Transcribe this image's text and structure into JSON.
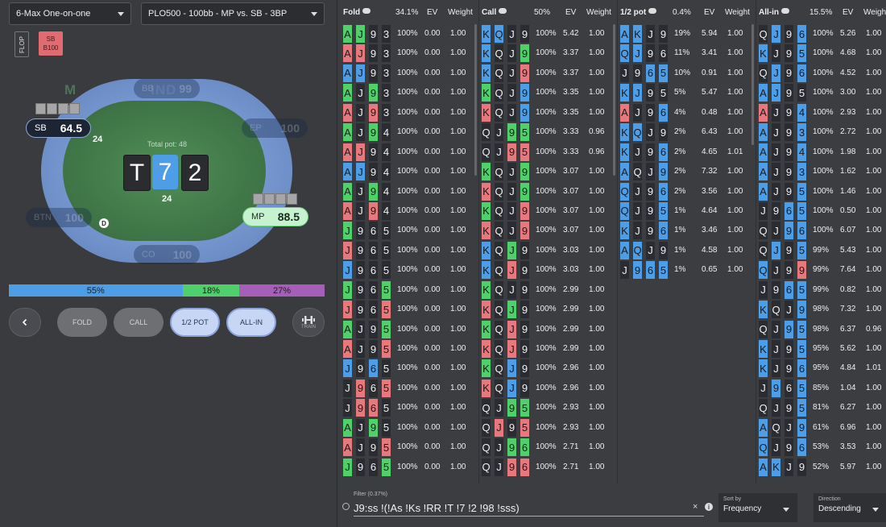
{
  "header": {
    "game_select": "6-Max One-on-one",
    "spot_select": "PLO500 - 100bb - MP vs. SB - 3BP"
  },
  "street_chip": "FLOP",
  "action_chip": {
    "line1": "SB",
    "line2": "B100"
  },
  "table": {
    "logo": "M",
    "logo_suffix": "IND",
    "total_pot": "Total pot: 48",
    "board": [
      {
        "rank": "T",
        "suit": "c"
      },
      {
        "rank": "7",
        "suit": "d"
      },
      {
        "rank": "2",
        "suit": "c"
      }
    ],
    "seats": {
      "bb": {
        "pos": "BB",
        "stack": "99"
      },
      "sb": {
        "pos": "SB",
        "stack": "64.5",
        "bet": "24"
      },
      "ep": {
        "pos": "EP",
        "stack": "100"
      },
      "btn": {
        "pos": "BTN",
        "stack": "100"
      },
      "mp": {
        "pos": "MP",
        "stack": "88.5",
        "bet": "24"
      },
      "co": {
        "pos": "CO",
        "stack": "100"
      }
    },
    "dealer": "D"
  },
  "freq_bar": [
    {
      "label": "55%",
      "value": 55,
      "color": "#4d9ee6"
    },
    {
      "label": "18%",
      "value": 18,
      "color": "#4fd06b"
    },
    {
      "label": "27%",
      "value": 27,
      "color": "#a65fb8"
    }
  ],
  "actions": {
    "fold": "FOLD",
    "call": "CALL",
    "half_pot": "1/2 POT",
    "all_in": "ALL-IN",
    "train": "TRAIN"
  },
  "columns": [
    {
      "name": "Fold",
      "pct": "34.1%",
      "ev_label": "EV",
      "weight_label": "Weight",
      "rows": [
        {
          "cards": [
            "As",
            "Js",
            "9c",
            "3c"
          ],
          "freq": "100%",
          "ev": "0.00",
          "w": "1.00"
        },
        {
          "cards": [
            "Ah",
            "Jh",
            "9c",
            "3c"
          ],
          "freq": "100%",
          "ev": "0.00",
          "w": "1.00"
        },
        {
          "cards": [
            "Ad",
            "Jd",
            "9c",
            "3c"
          ],
          "freq": "100%",
          "ev": "0.00",
          "w": "1.00"
        },
        {
          "cards": [
            "As",
            "Jc",
            "9s",
            "3c"
          ],
          "freq": "100%",
          "ev": "0.00",
          "w": "1.00"
        },
        {
          "cards": [
            "Ah",
            "Jc",
            "9h",
            "3c"
          ],
          "freq": "100%",
          "ev": "0.00",
          "w": "1.00"
        },
        {
          "cards": [
            "As",
            "Jc",
            "9s",
            "4c"
          ],
          "freq": "100%",
          "ev": "0.00",
          "w": "1.00"
        },
        {
          "cards": [
            "Ah",
            "Jh",
            "9c",
            "4c"
          ],
          "freq": "100%",
          "ev": "0.00",
          "w": "1.00"
        },
        {
          "cards": [
            "Ad",
            "Jd",
            "9c",
            "4c"
          ],
          "freq": "100%",
          "ev": "0.00",
          "w": "1.00"
        },
        {
          "cards": [
            "As",
            "Jc",
            "9s",
            "4c"
          ],
          "freq": "100%",
          "ev": "0.00",
          "w": "1.00"
        },
        {
          "cards": [
            "Ah",
            "Jc",
            "9h",
            "4c"
          ],
          "freq": "100%",
          "ev": "0.00",
          "w": "1.00"
        },
        {
          "cards": [
            "Js",
            "9c",
            "6c",
            "5c"
          ],
          "freq": "100%",
          "ev": "0.00",
          "w": "1.00"
        },
        {
          "cards": [
            "Jh",
            "9c",
            "6c",
            "5c"
          ],
          "freq": "100%",
          "ev": "0.00",
          "w": "1.00"
        },
        {
          "cards": [
            "Jd",
            "9c",
            "6c",
            "5c"
          ],
          "freq": "100%",
          "ev": "0.00",
          "w": "1.00"
        },
        {
          "cards": [
            "Js",
            "9c",
            "6c",
            "5s"
          ],
          "freq": "100%",
          "ev": "0.00",
          "w": "1.00"
        },
        {
          "cards": [
            "Jh",
            "9c",
            "6c",
            "5h"
          ],
          "freq": "100%",
          "ev": "0.00",
          "w": "1.00"
        },
        {
          "cards": [
            "As",
            "Jc",
            "9c",
            "5s"
          ],
          "freq": "100%",
          "ev": "0.00",
          "w": "1.00"
        },
        {
          "cards": [
            "Ah",
            "Jc",
            "9c",
            "5h"
          ],
          "freq": "100%",
          "ev": "0.00",
          "w": "1.00"
        },
        {
          "cards": [
            "Jd",
            "9c",
            "6d",
            "5c"
          ],
          "freq": "100%",
          "ev": "0.00",
          "w": "1.00"
        },
        {
          "cards": [
            "Jc",
            "9h",
            "6c",
            "5h"
          ],
          "freq": "100%",
          "ev": "0.00",
          "w": "1.00"
        },
        {
          "cards": [
            "Jc",
            "9h",
            "6h",
            "5c"
          ],
          "freq": "100%",
          "ev": "0.00",
          "w": "1.00"
        },
        {
          "cards": [
            "As",
            "Jc",
            "9s",
            "5c"
          ],
          "freq": "100%",
          "ev": "0.00",
          "w": "1.00"
        },
        {
          "cards": [
            "Ah",
            "Jc",
            "9c",
            "5h"
          ],
          "freq": "100%",
          "ev": "0.00",
          "w": "1.00"
        },
        {
          "cards": [
            "Js",
            "9c",
            "6c",
            "5s"
          ],
          "freq": "100%",
          "ev": "0.00",
          "w": "1.00"
        }
      ]
    },
    {
      "name": "Call",
      "pct": "50%",
      "ev_label": "EV",
      "weight_label": "Weight",
      "rows": [
        {
          "cards": [
            "Kd",
            "Qd",
            "Jc",
            "9c"
          ],
          "freq": "100%",
          "ev": "5.42",
          "w": "1.00"
        },
        {
          "cards": [
            "Kd",
            "Qc",
            "Jc",
            "9s"
          ],
          "freq": "100%",
          "ev": "3.37",
          "w": "1.00"
        },
        {
          "cards": [
            "Kd",
            "Qc",
            "Jc",
            "9h"
          ],
          "freq": "100%",
          "ev": "3.37",
          "w": "1.00"
        },
        {
          "cards": [
            "Ks",
            "Qc",
            "Jc",
            "9d"
          ],
          "freq": "100%",
          "ev": "3.35",
          "w": "1.00"
        },
        {
          "cards": [
            "Kh",
            "Qc",
            "Jc",
            "9d"
          ],
          "freq": "100%",
          "ev": "3.35",
          "w": "1.00"
        },
        {
          "cards": [
            "Qc",
            "Jc",
            "9s",
            "5s"
          ],
          "freq": "100%",
          "ev": "3.33",
          "w": "0.96"
        },
        {
          "cards": [
            "Qc",
            "Jc",
            "9h",
            "5h"
          ],
          "freq": "100%",
          "ev": "3.33",
          "w": "0.96"
        },
        {
          "cards": [
            "Ks",
            "Qc",
            "Jc",
            "9s"
          ],
          "freq": "100%",
          "ev": "3.07",
          "w": "1.00"
        },
        {
          "cards": [
            "Kh",
            "Qc",
            "Jc",
            "9s"
          ],
          "freq": "100%",
          "ev": "3.07",
          "w": "1.00"
        },
        {
          "cards": [
            "Ks",
            "Qc",
            "Jc",
            "9h"
          ],
          "freq": "100%",
          "ev": "3.07",
          "w": "1.00"
        },
        {
          "cards": [
            "Kh",
            "Qc",
            "Jc",
            "9h"
          ],
          "freq": "100%",
          "ev": "3.07",
          "w": "1.00"
        },
        {
          "cards": [
            "Kd",
            "Qc",
            "Js",
            "9c"
          ],
          "freq": "100%",
          "ev": "3.03",
          "w": "1.00"
        },
        {
          "cards": [
            "Kd",
            "Qc",
            "Jh",
            "9c"
          ],
          "freq": "100%",
          "ev": "3.03",
          "w": "1.00"
        },
        {
          "cards": [
            "Ks",
            "Qc",
            "Jc",
            "9c"
          ],
          "freq": "100%",
          "ev": "2.99",
          "w": "1.00"
        },
        {
          "cards": [
            "Kh",
            "Qc",
            "Js",
            "9c"
          ],
          "freq": "100%",
          "ev": "2.99",
          "w": "1.00"
        },
        {
          "cards": [
            "Ks",
            "Qc",
            "Jh",
            "9c"
          ],
          "freq": "100%",
          "ev": "2.99",
          "w": "1.00"
        },
        {
          "cards": [
            "Kh",
            "Qc",
            "Jh",
            "9c"
          ],
          "freq": "100%",
          "ev": "2.99",
          "w": "1.00"
        },
        {
          "cards": [
            "Ks",
            "Qc",
            "Jd",
            "9c"
          ],
          "freq": "100%",
          "ev": "2.96",
          "w": "1.00"
        },
        {
          "cards": [
            "Kh",
            "Qc",
            "Jd",
            "9c"
          ],
          "freq": "100%",
          "ev": "2.96",
          "w": "1.00"
        },
        {
          "cards": [
            "Qc",
            "Jc",
            "9s",
            "5s"
          ],
          "freq": "100%",
          "ev": "2.93",
          "w": "1.00"
        },
        {
          "cards": [
            "Qc",
            "Jh",
            "9c",
            "5h"
          ],
          "freq": "100%",
          "ev": "2.93",
          "w": "1.00"
        },
        {
          "cards": [
            "Qc",
            "Jc",
            "9s",
            "6s"
          ],
          "freq": "100%",
          "ev": "2.71",
          "w": "1.00"
        },
        {
          "cards": [
            "Qc",
            "Jc",
            "9h",
            "6h"
          ],
          "freq": "100%",
          "ev": "2.71",
          "w": "1.00"
        }
      ]
    },
    {
      "name": "1/2 pot",
      "pct": "0.4%",
      "ev_label": "EV",
      "weight_label": "Weight",
      "rows": [
        {
          "cards": [
            "Ad",
            "Kd",
            "Jc",
            "9c"
          ],
          "freq": "19%",
          "ev": "5.94",
          "w": "1.00"
        },
        {
          "cards": [
            "Qd",
            "Jd",
            "9c",
            "6c"
          ],
          "freq": "11%",
          "ev": "3.41",
          "w": "1.00"
        },
        {
          "cards": [
            "Jc",
            "9c",
            "6d",
            "5d"
          ],
          "freq": "10%",
          "ev": "0.91",
          "w": "1.00"
        },
        {
          "cards": [
            "Kd",
            "Jd",
            "9c",
            "5c"
          ],
          "freq": "5%",
          "ev": "5.47",
          "w": "1.00"
        },
        {
          "cards": [
            "Ah",
            "Jc",
            "9c",
            "6d"
          ],
          "freq": "4%",
          "ev": "0.48",
          "w": "1.00"
        },
        {
          "cards": [
            "Kd",
            "Qd",
            "Jc",
            "9c"
          ],
          "freq": "2%",
          "ev": "6.43",
          "w": "1.00"
        },
        {
          "cards": [
            "Kd",
            "Jc",
            "9c",
            "6d"
          ],
          "freq": "2%",
          "ev": "4.65",
          "w": "1.01"
        },
        {
          "cards": [
            "Ad",
            "Qc",
            "Jc",
            "9d"
          ],
          "freq": "2%",
          "ev": "7.32",
          "w": "1.00"
        },
        {
          "cards": [
            "Qd",
            "Jc",
            "9c",
            "6d"
          ],
          "freq": "2%",
          "ev": "3.56",
          "w": "1.00"
        },
        {
          "cards": [
            "Qd",
            "Jc",
            "9c",
            "5d"
          ],
          "freq": "1%",
          "ev": "4.64",
          "w": "1.00"
        },
        {
          "cards": [
            "Kd",
            "Jc",
            "9c",
            "6d"
          ],
          "freq": "1%",
          "ev": "3.46",
          "w": "1.00"
        },
        {
          "cards": [
            "Ad",
            "Qd",
            "Jc",
            "9c"
          ],
          "freq": "1%",
          "ev": "4.58",
          "w": "1.00"
        },
        {
          "cards": [
            "Jc",
            "9d",
            "6d",
            "5d"
          ],
          "freq": "1%",
          "ev": "0.65",
          "w": "1.00"
        }
      ]
    },
    {
      "name": "All-in",
      "pct": "15.5%",
      "ev_label": "EV",
      "weight_label": "Weigh",
      "rows": [
        {
          "cards": [
            "Qc",
            "Jd",
            "9c",
            "6d"
          ],
          "freq": "100%",
          "ev": "5.26",
          "w": "1.00"
        },
        {
          "cards": [
            "Kd",
            "Jc",
            "9c",
            "5d"
          ],
          "freq": "100%",
          "ev": "4.68",
          "w": "1.00"
        },
        {
          "cards": [
            "Qc",
            "Jd",
            "9c",
            "6d"
          ],
          "freq": "100%",
          "ev": "4.52",
          "w": "1.00"
        },
        {
          "cards": [
            "Ad",
            "Jd",
            "9c",
            "5c"
          ],
          "freq": "100%",
          "ev": "3.00",
          "w": "1.00"
        },
        {
          "cards": [
            "Ah",
            "Jc",
            "9c",
            "4d"
          ],
          "freq": "100%",
          "ev": "2.93",
          "w": "1.00"
        },
        {
          "cards": [
            "Ad",
            "Jc",
            "9c",
            "3d"
          ],
          "freq": "100%",
          "ev": "2.72",
          "w": "1.00"
        },
        {
          "cards": [
            "Ad",
            "Jc",
            "9c",
            "4d"
          ],
          "freq": "100%",
          "ev": "1.98",
          "w": "1.00"
        },
        {
          "cards": [
            "Ad",
            "Jc",
            "9c",
            "3d"
          ],
          "freq": "100%",
          "ev": "1.62",
          "w": "1.00"
        },
        {
          "cards": [
            "Ad",
            "Jc",
            "9c",
            "5d"
          ],
          "freq": "100%",
          "ev": "1.46",
          "w": "1.00"
        },
        {
          "cards": [
            "Jc",
            "9c",
            "6d",
            "5d"
          ],
          "freq": "100%",
          "ev": "0.50",
          "w": "1.00"
        },
        {
          "cards": [
            "Qc",
            "Jc",
            "9d",
            "6d"
          ],
          "freq": "100%",
          "ev": "6.07",
          "w": "1.00"
        },
        {
          "cards": [
            "Qc",
            "Jd",
            "9c",
            "5d"
          ],
          "freq": "99%",
          "ev": "5.43",
          "w": "1.00"
        },
        {
          "cards": [
            "Qd",
            "Jc",
            "9c",
            "9h"
          ],
          "freq": "99%",
          "ev": "7.64",
          "w": "1.00"
        },
        {
          "cards": [
            "Jc",
            "9c",
            "6d",
            "5d"
          ],
          "freq": "99%",
          "ev": "0.82",
          "w": "1.00"
        },
        {
          "cards": [
            "Kd",
            "Qc",
            "Jc",
            "9d"
          ],
          "freq": "98%",
          "ev": "7.32",
          "w": "1.00"
        },
        {
          "cards": [
            "Qc",
            "Jc",
            "9d",
            "5d"
          ],
          "freq": "98%",
          "ev": "6.37",
          "w": "0.96"
        },
        {
          "cards": [
            "Kd",
            "Jc",
            "9c",
            "5d"
          ],
          "freq": "95%",
          "ev": "5.62",
          "w": "1.00"
        },
        {
          "cards": [
            "Kd",
            "Jc",
            "9c",
            "6d"
          ],
          "freq": "95%",
          "ev": "4.84",
          "w": "1.01"
        },
        {
          "cards": [
            "Jc",
            "9d",
            "6c",
            "5d"
          ],
          "freq": "85%",
          "ev": "1.04",
          "w": "1.00"
        },
        {
          "cards": [
            "Qc",
            "Jc",
            "9c",
            "5d"
          ],
          "freq": "81%",
          "ev": "6.27",
          "w": "1.00"
        },
        {
          "cards": [
            "Ad",
            "Qc",
            "Jc",
            "9d"
          ],
          "freq": "61%",
          "ev": "6.96",
          "w": "1.00"
        },
        {
          "cards": [
            "Qd",
            "Jc",
            "9c",
            "6d"
          ],
          "freq": "53%",
          "ev": "3.53",
          "w": "1.00"
        },
        {
          "cards": [
            "Ad",
            "Kd",
            "Jc",
            "9c"
          ],
          "freq": "52%",
          "ev": "5.97",
          "w": "1.00"
        }
      ]
    }
  ],
  "filter": {
    "label": "Filter (0.37%)",
    "value": "J9:ss !(!As !Ks !RR !T !7 !2 !98 !sss)",
    "clear": "×",
    "info": "i"
  },
  "sort_by": {
    "label": "Sort by",
    "value": "Frequency"
  },
  "direction": {
    "label": "Direction",
    "value": "Descending"
  }
}
